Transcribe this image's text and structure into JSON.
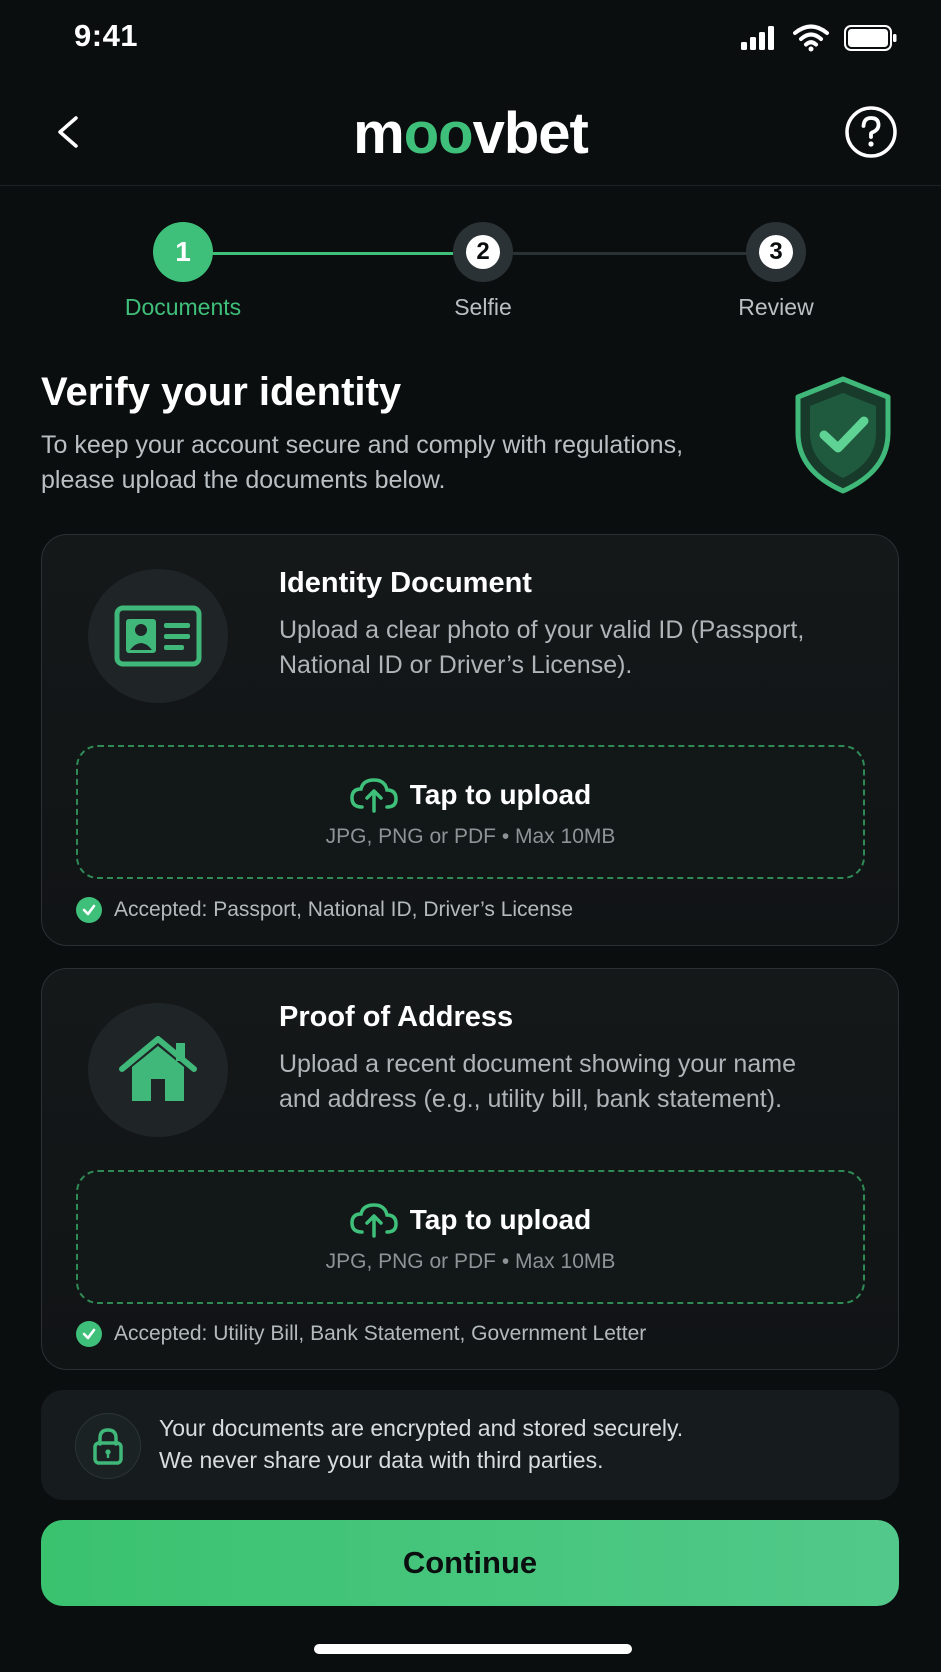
{
  "status_bar": {
    "time": "9:41"
  },
  "header": {
    "logo_prefix": "m",
    "logo_accent": "oo",
    "logo_suffix": "vbet"
  },
  "stepper": {
    "steps": [
      {
        "number": "1",
        "label": "Documents",
        "state": "active"
      },
      {
        "number": "2",
        "label": "Selfie",
        "state": "pending"
      },
      {
        "number": "3",
        "label": "Review",
        "state": "pending"
      }
    ]
  },
  "page": {
    "title": "Verify your identity",
    "subtitle": "To keep your account secure and comply with regulations, please upload the documents below."
  },
  "cards": [
    {
      "title": "Identity Document",
      "description": "Upload a clear photo of your valid ID (Passport, National ID or Driver’s License).",
      "upload_label": "Tap to upload",
      "upload_hint": "JPG, PNG or PDF • Max 10MB",
      "accepted": "Accepted: Passport, National ID, Driver’s License",
      "icon": "id-card-icon"
    },
    {
      "title": "Proof of Address",
      "description": "Upload a recent document showing your name and address (e.g., utility bill, bank statement).",
      "upload_label": "Tap to upload",
      "upload_hint": "JPG, PNG or PDF • Max 10MB",
      "accepted": "Accepted: Utility Bill, Bank Statement, Government Letter",
      "icon": "house-icon"
    }
  ],
  "security_note": {
    "line1": "Your documents are encrypted and stored securely.",
    "line2": "We never share your data with third parties."
  },
  "continue_button": {
    "label": "Continue"
  },
  "colors": {
    "accent": "#3fc07a",
    "background": "#0b0e0f",
    "card": "#141819",
    "pending_step": "#2b3235"
  }
}
